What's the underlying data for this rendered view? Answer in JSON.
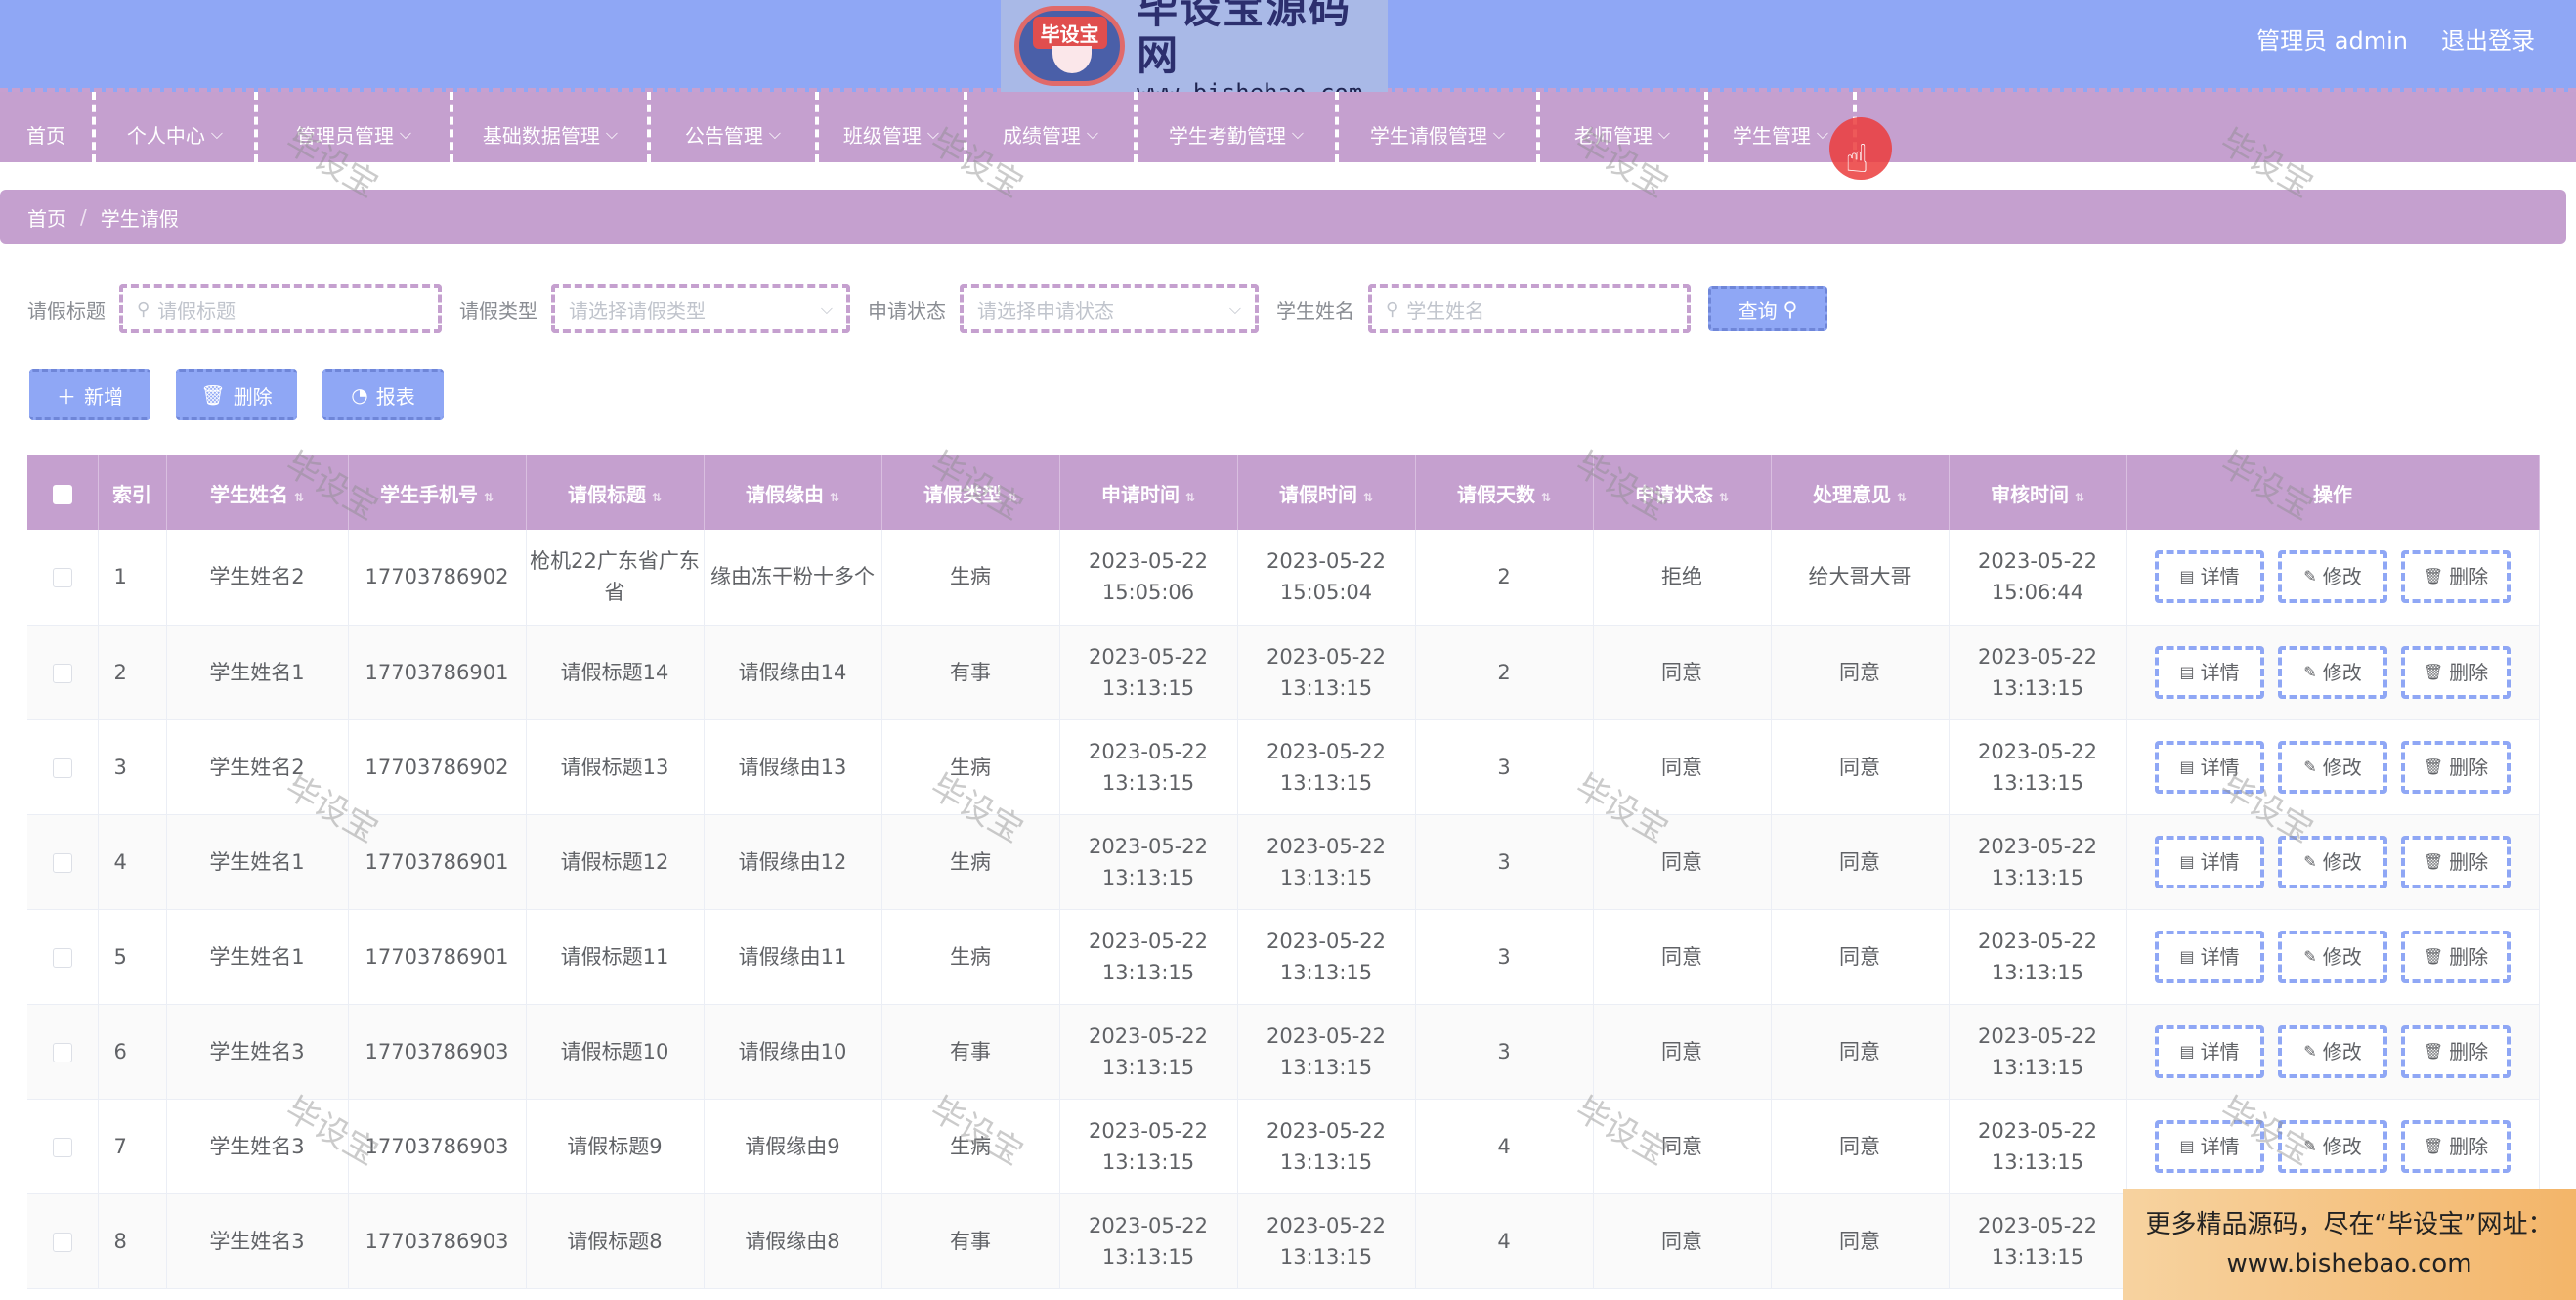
{
  "header": {
    "logo_cn": "毕设宝源码网",
    "logo_url": "www.bishehao.com",
    "logo_badge": "毕设宝",
    "admin_label": "管理员 admin",
    "logout_label": "退出登录"
  },
  "nav": {
    "items": [
      {
        "label": "首页",
        "dropdown": false
      },
      {
        "label": "个人中心",
        "dropdown": true
      },
      {
        "label": "管理员管理",
        "dropdown": true
      },
      {
        "label": "基础数据管理",
        "dropdown": true
      },
      {
        "label": "公告管理",
        "dropdown": true
      },
      {
        "label": "班级管理",
        "dropdown": true
      },
      {
        "label": "成绩管理",
        "dropdown": true
      },
      {
        "label": "学生考勤管理",
        "dropdown": true
      },
      {
        "label": "学生请假管理",
        "dropdown": true
      },
      {
        "label": "老师管理",
        "dropdown": true
      },
      {
        "label": "学生管理",
        "dropdown": true
      }
    ]
  },
  "breadcrumb": {
    "home": "首页",
    "current": "学生请假"
  },
  "search": {
    "title_label": "请假标题",
    "title_placeholder": "请假标题",
    "type_label": "请假类型",
    "type_placeholder": "请选择请假类型",
    "status_label": "申请状态",
    "status_placeholder": "请选择申请状态",
    "name_label": "学生姓名",
    "name_placeholder": "学生姓名",
    "query_label": "查询"
  },
  "actions": {
    "add": "新增",
    "delete": "删除",
    "report": "报表"
  },
  "table": {
    "headers": [
      "索引",
      "学生姓名",
      "学生手机号",
      "请假标题",
      "请假缘由",
      "请假类型",
      "申请时间",
      "请假时间",
      "请假天数",
      "申请状态",
      "处理意见",
      "审核时间",
      "操作"
    ],
    "op_labels": {
      "detail": "详情",
      "edit": "修改",
      "delete": "删除"
    },
    "rows": [
      {
        "idx": "1",
        "name": "学生姓名2",
        "phone": "17703786902",
        "title": "枪机22广东省广东省",
        "reason": "缘由冻干粉十多个",
        "type": "生病",
        "apply": "2023-05-22 15:05:06",
        "leave": "2023-05-22 15:05:04",
        "days": "2",
        "status": "拒绝",
        "opinion": "给大哥大哥",
        "audit": "2023-05-22 15:06:44"
      },
      {
        "idx": "2",
        "name": "学生姓名1",
        "phone": "17703786901",
        "title": "请假标题14",
        "reason": "请假缘由14",
        "type": "有事",
        "apply": "2023-05-22 13:13:15",
        "leave": "2023-05-22 13:13:15",
        "days": "2",
        "status": "同意",
        "opinion": "同意",
        "audit": "2023-05-22 13:13:15"
      },
      {
        "idx": "3",
        "name": "学生姓名2",
        "phone": "17703786902",
        "title": "请假标题13",
        "reason": "请假缘由13",
        "type": "生病",
        "apply": "2023-05-22 13:13:15",
        "leave": "2023-05-22 13:13:15",
        "days": "3",
        "status": "同意",
        "opinion": "同意",
        "audit": "2023-05-22 13:13:15"
      },
      {
        "idx": "4",
        "name": "学生姓名1",
        "phone": "17703786901",
        "title": "请假标题12",
        "reason": "请假缘由12",
        "type": "生病",
        "apply": "2023-05-22 13:13:15",
        "leave": "2023-05-22 13:13:15",
        "days": "3",
        "status": "同意",
        "opinion": "同意",
        "audit": "2023-05-22 13:13:15"
      },
      {
        "idx": "5",
        "name": "学生姓名1",
        "phone": "17703786901",
        "title": "请假标题11",
        "reason": "请假缘由11",
        "type": "生病",
        "apply": "2023-05-22 13:13:15",
        "leave": "2023-05-22 13:13:15",
        "days": "3",
        "status": "同意",
        "opinion": "同意",
        "audit": "2023-05-22 13:13:15"
      },
      {
        "idx": "6",
        "name": "学生姓名3",
        "phone": "17703786903",
        "title": "请假标题10",
        "reason": "请假缘由10",
        "type": "有事",
        "apply": "2023-05-22 13:13:15",
        "leave": "2023-05-22 13:13:15",
        "days": "3",
        "status": "同意",
        "opinion": "同意",
        "audit": "2023-05-22 13:13:15"
      },
      {
        "idx": "7",
        "name": "学生姓名3",
        "phone": "17703786903",
        "title": "请假标题9",
        "reason": "请假缘由9",
        "type": "生病",
        "apply": "2023-05-22 13:13:15",
        "leave": "2023-05-22 13:13:15",
        "days": "4",
        "status": "同意",
        "opinion": "同意",
        "audit": "2023-05-22 13:13:15"
      },
      {
        "idx": "8",
        "name": "学生姓名3",
        "phone": "17703786903",
        "title": "请假标题8",
        "reason": "请假缘由8",
        "type": "有事",
        "apply": "2023-05-22 13:13:15",
        "leave": "2023-05-22 13:13:15",
        "days": "4",
        "status": "同意",
        "opinion": "同意",
        "audit": "2023-05-22 13:13:15"
      }
    ]
  },
  "watermark_text": "毕设宝",
  "promo": {
    "line1": "更多精品源码，尽在“毕设宝”网址：",
    "line2": "www.bishebao.com"
  },
  "colors": {
    "header": "#8fa7f5",
    "accent": "#c5a0cf",
    "button": "#8fa7f5"
  }
}
